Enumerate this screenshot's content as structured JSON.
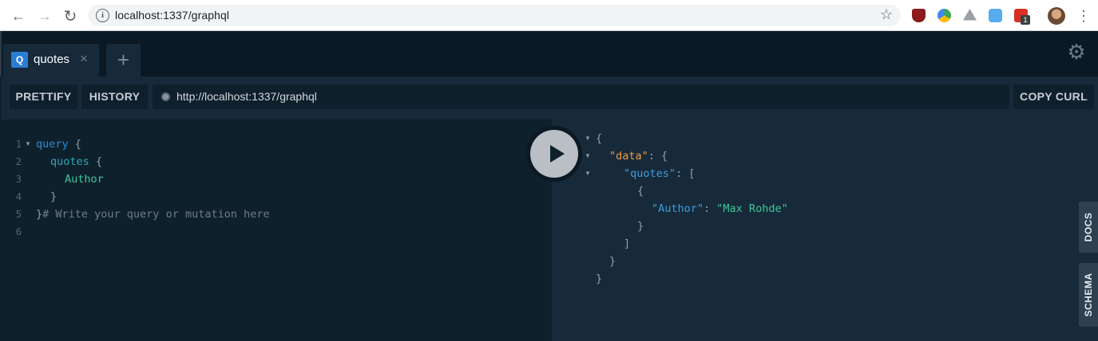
{
  "browser": {
    "url": "localhost:1337/graphql",
    "back_icon": "←",
    "forward_icon": "→",
    "reload_icon": "↻",
    "star_icon": "☆",
    "menu_icon": "⋮",
    "extensions": [
      {
        "name": "ublock-icon",
        "color": "#8b1a1a"
      },
      {
        "name": "sync-icon",
        "color": "#3aa757"
      },
      {
        "name": "drive-icon",
        "color": "#9aa0a6"
      },
      {
        "name": "twitter-icon",
        "color": "#55acee"
      },
      {
        "name": "notification-badge-icon",
        "color": "#d93025",
        "count": "1"
      }
    ]
  },
  "tabs": {
    "items": [
      {
        "badge": "Q",
        "label": "quotes",
        "close": "×"
      }
    ],
    "add_icon": "+",
    "settings_icon": "⚙"
  },
  "toolbar": {
    "prettify": "PRETTIFY",
    "history": "HISTORY",
    "endpoint": "http://localhost:1337/graphql",
    "copy_curl": "COPY CURL"
  },
  "query_editor": {
    "line_numbers": [
      "1",
      "2",
      "3",
      "4",
      "5",
      "6"
    ],
    "lines": {
      "l1_kw": "query",
      "l1_brace": " {",
      "l2_field": "quotes",
      "l2_brace": " {",
      "l3_leaf": "Author",
      "l4_brace": "}",
      "l5_brace": "}",
      "l5_comment": "# Write your query or mutation here"
    }
  },
  "result": {
    "open_brace": "{",
    "data_key": "\"data\"",
    "data_sep": ": {",
    "quotes_key": "\"quotes\"",
    "quotes_sep": ": [",
    "item_open": "{",
    "author_key": "\"Author\"",
    "author_sep": ": ",
    "author_value": "\"Max Rohde\"",
    "item_close": "}",
    "array_close": "]",
    "data_close": "}",
    "root_close": "}"
  },
  "side_tabs": {
    "docs": "DOCS",
    "schema": "SCHEMA"
  }
}
